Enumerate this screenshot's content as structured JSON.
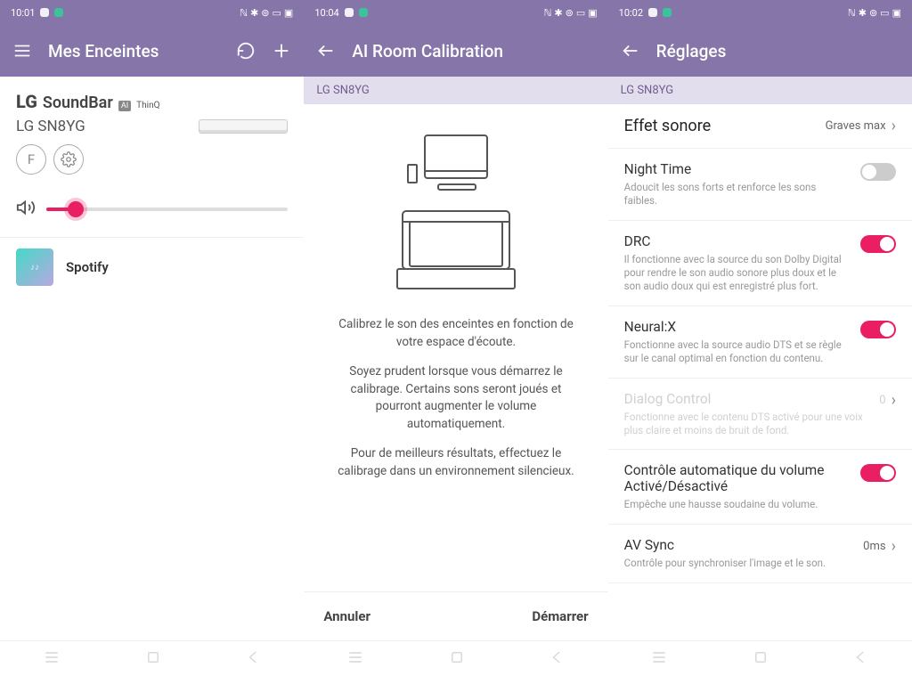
{
  "screens": {
    "s1": {
      "status": {
        "time": "10:01"
      },
      "appbar": {
        "title": "Mes Enceintes"
      },
      "card": {
        "brand_lg": "LG",
        "brand_sb": "SoundBar",
        "brand_ai": "AI",
        "brand_thinq": "ThinQ",
        "model": "LG SN8YG",
        "mode_btn": "F"
      },
      "source": {
        "name": "Spotify"
      }
    },
    "s2": {
      "status": {
        "time": "10:04"
      },
      "appbar": {
        "title": "AI Room Calibration"
      },
      "sub_header": "LG SN8YG",
      "text": {
        "p1": "Calibrez le son des enceintes en fonction de votre espace d'écoute.",
        "p2": "Soyez prudent lorsque vous démarrez le calibrage. Certains sons seront joués et pourront augmenter le volume automatiquement.",
        "p3": "Pour de meilleurs résultats, effectuez le calibrage dans un environnement silencieux."
      },
      "actions": {
        "cancel": "Annuler",
        "start": "Démarrer"
      }
    },
    "s3": {
      "status": {
        "time": "10:02"
      },
      "appbar": {
        "title": "Réglages"
      },
      "sub_header": "LG SN8YG",
      "effect": {
        "label": "Effet sonore",
        "value": "Graves max"
      },
      "items": [
        {
          "title": "Night Time",
          "desc": "Adoucit les sons forts et renforce les sons faibles.",
          "on": false
        },
        {
          "title": "DRC",
          "desc": "Il fonctionne avec la source du son Dolby Digital pour rendre le son audio sonore plus doux et le son audio doux qui est enregistré plus fort.",
          "on": true
        },
        {
          "title": "Neural:X",
          "desc": "Fonctionne avec la source audio DTS et se règle sur le canal optimal en fonction du contenu.",
          "on": true
        }
      ],
      "dialog": {
        "title": "Dialog Control",
        "desc": "Fonctionne avec le contenu DTS activé pour une voix plus claire et moins de bruit de fond.",
        "value": "0"
      },
      "autovol": {
        "title": "Contrôle automatique du volume Activé/Désactivé",
        "desc": "Empêche une hausse soudaine du volume.",
        "on": true
      },
      "avsync": {
        "title": "AV Sync",
        "desc": "Contrôle pour synchroniser l'image et le son.",
        "value": "0ms"
      }
    }
  }
}
